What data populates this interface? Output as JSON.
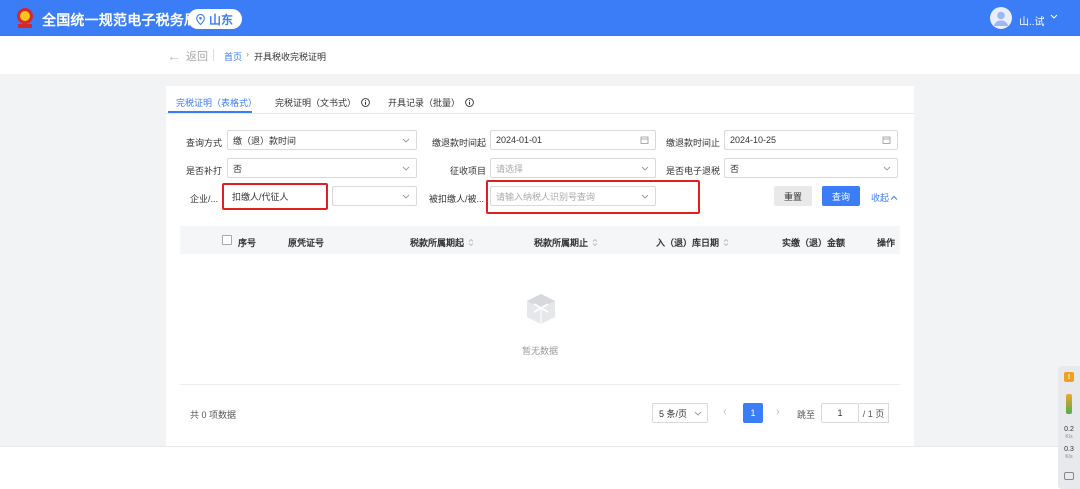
{
  "header": {
    "site_title": "全国统一规范电子税务局",
    "region": "山东",
    "user_name": "山..试",
    "logo_text": "国家税务总局"
  },
  "breadcrumb": {
    "back": "返回",
    "home": "首页",
    "separator": "›",
    "current": "开具税收完税证明"
  },
  "tabs": [
    {
      "label": "完税证明（表格式）",
      "active": true
    },
    {
      "label": "完税证明（文书式）",
      "info_icon": true
    },
    {
      "label": "开具记录（批量）",
      "info_icon": true
    }
  ],
  "filters": {
    "query_method": {
      "label": "查询方式",
      "value": "缴（退）款时间"
    },
    "date_from": {
      "label": "缴退款时间起",
      "value": "2024-01-01"
    },
    "date_to": {
      "label": "缴退款时间止",
      "value": "2024-10-25"
    },
    "reissue": {
      "label": "是否补打",
      "value": "否"
    },
    "levy_item": {
      "label": "征收项目",
      "placeholder": "请选择"
    },
    "e_refund": {
      "label": "是否电子退税",
      "value": "否"
    },
    "enterprise": {
      "label": "企业/...",
      "value": "扣缴人/代征人"
    },
    "enterprise_sub": {
      "value": ""
    },
    "withheld": {
      "label": "被扣缴人/被...",
      "placeholder": "请输入纳税人识别号查询"
    }
  },
  "actions": {
    "reset": "重置",
    "search": "查询",
    "collapse": "收起"
  },
  "table": {
    "columns": [
      "序号",
      "原凭证号",
      "税款所属期起",
      "税款所属期止",
      "入（退）库日期",
      "实缴（退）金额",
      "操作"
    ],
    "rows": [],
    "empty_text": "暂无数据"
  },
  "pagination": {
    "total_text": "共 0 项数据",
    "page_size": "5 条/页",
    "current_page": "1",
    "jump_label": "跳至",
    "jump_value": "1",
    "total_pages": "/ 1 页"
  },
  "float_widget": {
    "badge": "!",
    "stat1": "0.2",
    "stat1_unit": "K/s",
    "stat2": "0.3",
    "stat2_unit": "K/s"
  },
  "colors": {
    "primary": "#3b7df7",
    "highlight_box": "#e02020"
  }
}
